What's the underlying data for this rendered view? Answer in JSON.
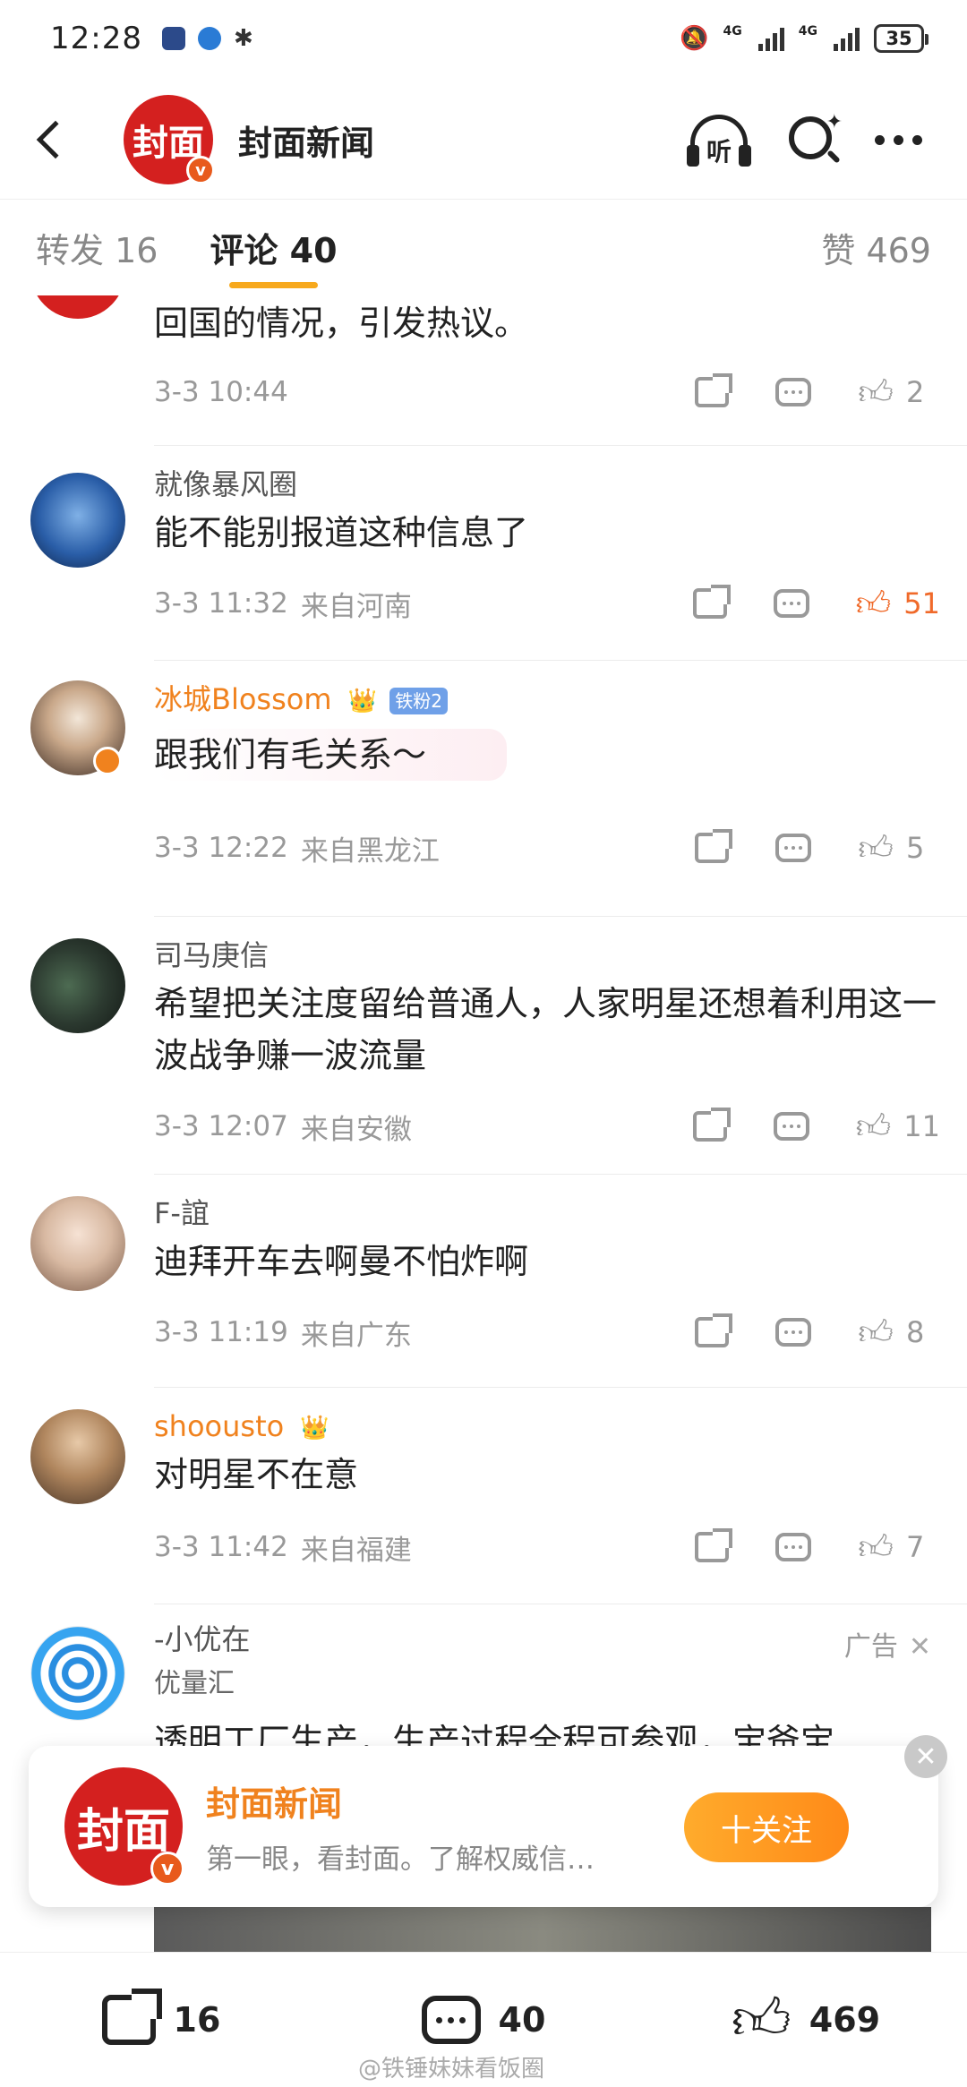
{
  "status_bar": {
    "time": "12:28",
    "network": "4G",
    "battery": "35"
  },
  "header": {
    "account_avatar_text": "封面",
    "verified_badge": "v",
    "title": "封面新闻",
    "listen_label": "听"
  },
  "tabs": [
    {
      "label": "转发 16",
      "active": false
    },
    {
      "label": "评论 40",
      "active": true
    },
    {
      "label": "赞 469",
      "active": false
    }
  ],
  "comments": [
    {
      "username": "",
      "text": "回国的情况，引发热议。",
      "time": "3-3 10:44",
      "location": "",
      "likes": "2",
      "liked": false
    },
    {
      "username": "就像暴风圈",
      "text": "能不能别报道这种信息了",
      "time": "3-3 11:32",
      "location": "来自河南",
      "likes": "51",
      "liked": true
    },
    {
      "username": "冰城Blossom",
      "fan_badge": "铁粉2",
      "text": "跟我们有毛关系～",
      "time": "3-3 12:22",
      "location": "来自黑龙江",
      "likes": "5",
      "liked": false
    },
    {
      "username": "司马庚信",
      "text": "希望把关注度留给普通人，人家明星还想着利用这一波战争赚一波流量",
      "time": "3-3 12:07",
      "location": "来自安徽",
      "likes": "11",
      "liked": false
    },
    {
      "username": "F-誼",
      "text": "迪拜开车去啊曼不怕炸啊",
      "time": "3-3 11:19",
      "location": "来自广东",
      "likes": "8",
      "liked": false
    },
    {
      "username": "shoousto",
      "text": "对明星不在意",
      "time": "3-3 11:42",
      "location": "来自福建",
      "likes": "7",
      "liked": false
    }
  ],
  "ad": {
    "username": "-小优在",
    "subtitle": "优量汇",
    "label": "广告",
    "text": "透明工厂生产，生产过程全程可参观，宝爸宝"
  },
  "follow_card": {
    "avatar_text": "封面",
    "name": "封面新闻",
    "description": "第一眼，看封面。了解权威信…",
    "follow_label": "十关注"
  },
  "bottom_bar": {
    "shares": "16",
    "comments": "40",
    "likes": "469"
  },
  "watermark": "@铁锤妹妹看饭圈",
  "colors": {
    "accent_orange": "#f0821e",
    "liked": "#f06a2a",
    "brand_red": "#d4201f",
    "tab_underline": "#f7a91d"
  }
}
